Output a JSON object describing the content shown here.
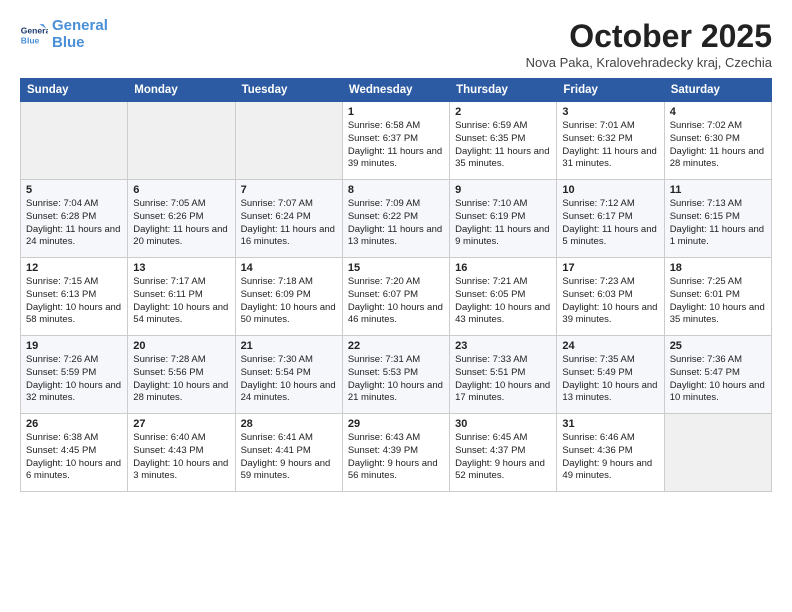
{
  "header": {
    "logo_line1": "General",
    "logo_line2": "Blue",
    "month": "October 2025",
    "location": "Nova Paka, Kralovehradecky kraj, Czechia"
  },
  "weekdays": [
    "Sunday",
    "Monday",
    "Tuesday",
    "Wednesday",
    "Thursday",
    "Friday",
    "Saturday"
  ],
  "weeks": [
    [
      {
        "day": "",
        "info": ""
      },
      {
        "day": "",
        "info": ""
      },
      {
        "day": "",
        "info": ""
      },
      {
        "day": "1",
        "info": "Sunrise: 6:58 AM\nSunset: 6:37 PM\nDaylight: 11 hours and 39 minutes."
      },
      {
        "day": "2",
        "info": "Sunrise: 6:59 AM\nSunset: 6:35 PM\nDaylight: 11 hours and 35 minutes."
      },
      {
        "day": "3",
        "info": "Sunrise: 7:01 AM\nSunset: 6:32 PM\nDaylight: 11 hours and 31 minutes."
      },
      {
        "day": "4",
        "info": "Sunrise: 7:02 AM\nSunset: 6:30 PM\nDaylight: 11 hours and 28 minutes."
      }
    ],
    [
      {
        "day": "5",
        "info": "Sunrise: 7:04 AM\nSunset: 6:28 PM\nDaylight: 11 hours and 24 minutes."
      },
      {
        "day": "6",
        "info": "Sunrise: 7:05 AM\nSunset: 6:26 PM\nDaylight: 11 hours and 20 minutes."
      },
      {
        "day": "7",
        "info": "Sunrise: 7:07 AM\nSunset: 6:24 PM\nDaylight: 11 hours and 16 minutes."
      },
      {
        "day": "8",
        "info": "Sunrise: 7:09 AM\nSunset: 6:22 PM\nDaylight: 11 hours and 13 minutes."
      },
      {
        "day": "9",
        "info": "Sunrise: 7:10 AM\nSunset: 6:19 PM\nDaylight: 11 hours and 9 minutes."
      },
      {
        "day": "10",
        "info": "Sunrise: 7:12 AM\nSunset: 6:17 PM\nDaylight: 11 hours and 5 minutes."
      },
      {
        "day": "11",
        "info": "Sunrise: 7:13 AM\nSunset: 6:15 PM\nDaylight: 11 hours and 1 minute."
      }
    ],
    [
      {
        "day": "12",
        "info": "Sunrise: 7:15 AM\nSunset: 6:13 PM\nDaylight: 10 hours and 58 minutes."
      },
      {
        "day": "13",
        "info": "Sunrise: 7:17 AM\nSunset: 6:11 PM\nDaylight: 10 hours and 54 minutes."
      },
      {
        "day": "14",
        "info": "Sunrise: 7:18 AM\nSunset: 6:09 PM\nDaylight: 10 hours and 50 minutes."
      },
      {
        "day": "15",
        "info": "Sunrise: 7:20 AM\nSunset: 6:07 PM\nDaylight: 10 hours and 46 minutes."
      },
      {
        "day": "16",
        "info": "Sunrise: 7:21 AM\nSunset: 6:05 PM\nDaylight: 10 hours and 43 minutes."
      },
      {
        "day": "17",
        "info": "Sunrise: 7:23 AM\nSunset: 6:03 PM\nDaylight: 10 hours and 39 minutes."
      },
      {
        "day": "18",
        "info": "Sunrise: 7:25 AM\nSunset: 6:01 PM\nDaylight: 10 hours and 35 minutes."
      }
    ],
    [
      {
        "day": "19",
        "info": "Sunrise: 7:26 AM\nSunset: 5:59 PM\nDaylight: 10 hours and 32 minutes."
      },
      {
        "day": "20",
        "info": "Sunrise: 7:28 AM\nSunset: 5:56 PM\nDaylight: 10 hours and 28 minutes."
      },
      {
        "day": "21",
        "info": "Sunrise: 7:30 AM\nSunset: 5:54 PM\nDaylight: 10 hours and 24 minutes."
      },
      {
        "day": "22",
        "info": "Sunrise: 7:31 AM\nSunset: 5:53 PM\nDaylight: 10 hours and 21 minutes."
      },
      {
        "day": "23",
        "info": "Sunrise: 7:33 AM\nSunset: 5:51 PM\nDaylight: 10 hours and 17 minutes."
      },
      {
        "day": "24",
        "info": "Sunrise: 7:35 AM\nSunset: 5:49 PM\nDaylight: 10 hours and 13 minutes."
      },
      {
        "day": "25",
        "info": "Sunrise: 7:36 AM\nSunset: 5:47 PM\nDaylight: 10 hours and 10 minutes."
      }
    ],
    [
      {
        "day": "26",
        "info": "Sunrise: 6:38 AM\nSunset: 4:45 PM\nDaylight: 10 hours and 6 minutes."
      },
      {
        "day": "27",
        "info": "Sunrise: 6:40 AM\nSunset: 4:43 PM\nDaylight: 10 hours and 3 minutes."
      },
      {
        "day": "28",
        "info": "Sunrise: 6:41 AM\nSunset: 4:41 PM\nDaylight: 9 hours and 59 minutes."
      },
      {
        "day": "29",
        "info": "Sunrise: 6:43 AM\nSunset: 4:39 PM\nDaylight: 9 hours and 56 minutes."
      },
      {
        "day": "30",
        "info": "Sunrise: 6:45 AM\nSunset: 4:37 PM\nDaylight: 9 hours and 52 minutes."
      },
      {
        "day": "31",
        "info": "Sunrise: 6:46 AM\nSunset: 4:36 PM\nDaylight: 9 hours and 49 minutes."
      },
      {
        "day": "",
        "info": ""
      }
    ]
  ]
}
